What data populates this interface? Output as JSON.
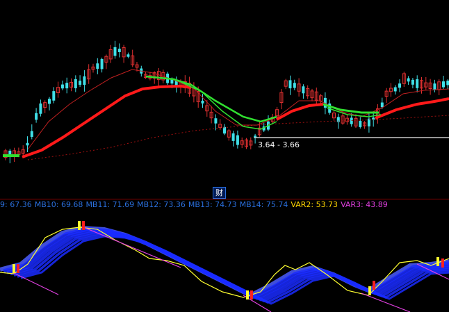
{
  "price_marker": {
    "text": "3.64 - 3.66"
  },
  "divider_button": {
    "icon": "finance-icon",
    "glyph": "财"
  },
  "indicator_legend": [
    {
      "text": "9: 67.36",
      "color": "#2a6fdc"
    },
    {
      "text": "MB10: 69.68",
      "color": "#2a6fdc"
    },
    {
      "text": "MB11: 71.69",
      "color": "#2a6fdc"
    },
    {
      "text": "MB12: 73.36",
      "color": "#2a6fdc"
    },
    {
      "text": "MB13: 74.73",
      "color": "#2a6fdc"
    },
    {
      "text": "MB14: 75.74",
      "color": "#2a6fdc"
    },
    {
      "text": "VAR2: 53.73",
      "color": "#ffd700"
    },
    {
      "text": "VAR3: 43.89",
      "color": "#e040e0"
    }
  ],
  "colors": {
    "up": "#e03030",
    "down": "#40e0e8",
    "ma_main": "#ff1a1a",
    "ma_green": "#30e030",
    "ribbon": "#1a2cff",
    "var2": "#ffff30",
    "var3": "#e040e0"
  }
}
